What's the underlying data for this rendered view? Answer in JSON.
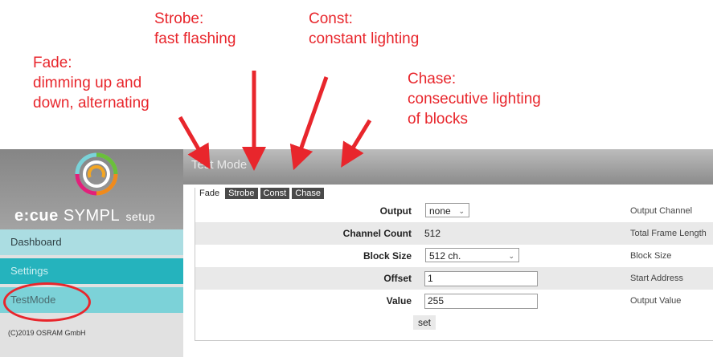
{
  "annotations": {
    "fade": {
      "line1": "Fade:",
      "line2": "dimming up and",
      "line3": "down, alternating"
    },
    "strobe": {
      "line1": "Strobe:",
      "line2": "fast flashing"
    },
    "const": {
      "line1": "Const:",
      "line2": "constant lighting"
    },
    "chase": {
      "line1": "Chase:",
      "line2": "consecutive lighting",
      "line3": "of blocks"
    },
    "color": "#e8262c"
  },
  "sidebar": {
    "brand": {
      "ecue": "e:cue",
      "sympl": "SYMPL",
      "setup": "setup"
    },
    "items": [
      {
        "label": "Dashboard"
      },
      {
        "label": "Settings"
      },
      {
        "label": "TestMode"
      }
    ],
    "copyright": "(C)2019 OSRAM GmbH"
  },
  "main": {
    "title": "Test Mode",
    "tabs": [
      {
        "label": "Fade",
        "active": true
      },
      {
        "label": "Strobe",
        "active": false
      },
      {
        "label": "Const",
        "active": false
      },
      {
        "label": "Chase",
        "active": false
      }
    ],
    "fields": {
      "output": {
        "label": "Output",
        "value": "none",
        "desc": "Output Channel"
      },
      "channel_count": {
        "label": "Channel Count",
        "value": "512",
        "desc": "Total Frame Length"
      },
      "block_size": {
        "label": "Block Size",
        "value": "512 ch.",
        "desc": "Block Size"
      },
      "offset": {
        "label": "Offset",
        "value": "1",
        "desc": "Start Address"
      },
      "value": {
        "label": "Value",
        "value": "255",
        "desc": "Output Value"
      }
    },
    "set_label": "set"
  },
  "colors": {
    "teal_active": "#25b3bd",
    "teal_light": "#abdde2",
    "teal_mid": "#7cd2d8",
    "header_gray": "#8b8b8b"
  }
}
